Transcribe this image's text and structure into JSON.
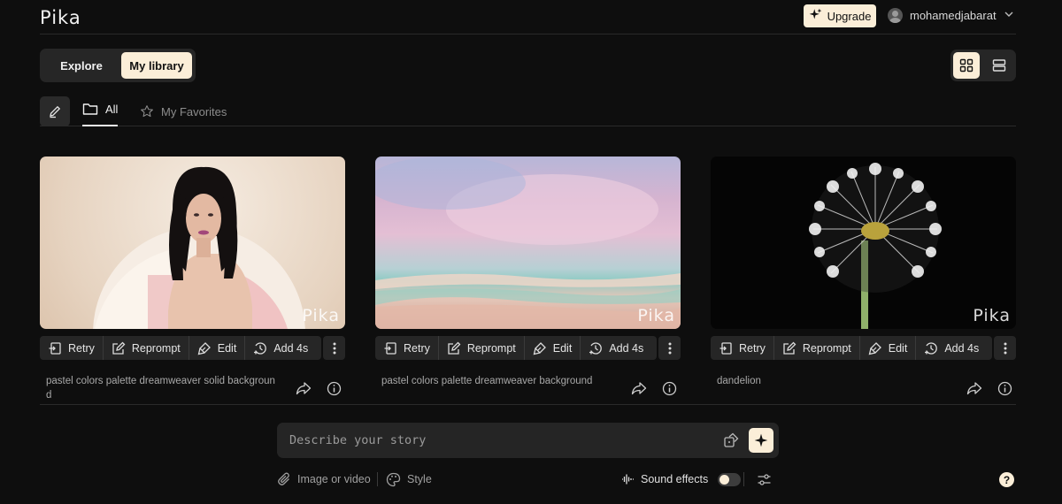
{
  "header": {
    "logo": "Pika",
    "upgrade_label": "Upgrade",
    "username": "mohamedjabarat"
  },
  "nav": {
    "explore_label": "Explore",
    "library_label": "My library"
  },
  "tabs": {
    "all_label": "All",
    "favorites_label": "My Favorites"
  },
  "cards": [
    {
      "watermark": "Pika",
      "caption": "pastel colors palette dreamweaver solid background",
      "actions": {
        "retry": "Retry",
        "reprompt": "Reprompt",
        "edit": "Edit",
        "add": "Add 4s"
      }
    },
    {
      "watermark": "Pika",
      "caption": "pastel colors palette dreamweaver background",
      "actions": {
        "retry": "Retry",
        "reprompt": "Reprompt",
        "edit": "Edit",
        "add": "Add 4s"
      }
    },
    {
      "watermark": "Pika",
      "caption": "dandelion",
      "actions": {
        "retry": "Retry",
        "reprompt": "Reprompt",
        "edit": "Edit",
        "add": "Add 4s"
      }
    }
  ],
  "prompt": {
    "placeholder": "Describe your story"
  },
  "toolbar": {
    "image_video_label": "Image or video",
    "style_label": "Style",
    "sound_effects_label": "Sound effects",
    "sound_effects_on": false,
    "help_label": "?"
  },
  "colors": {
    "background": "#0e0e0e",
    "accent": "#fbeed8",
    "panel": "#262626"
  }
}
